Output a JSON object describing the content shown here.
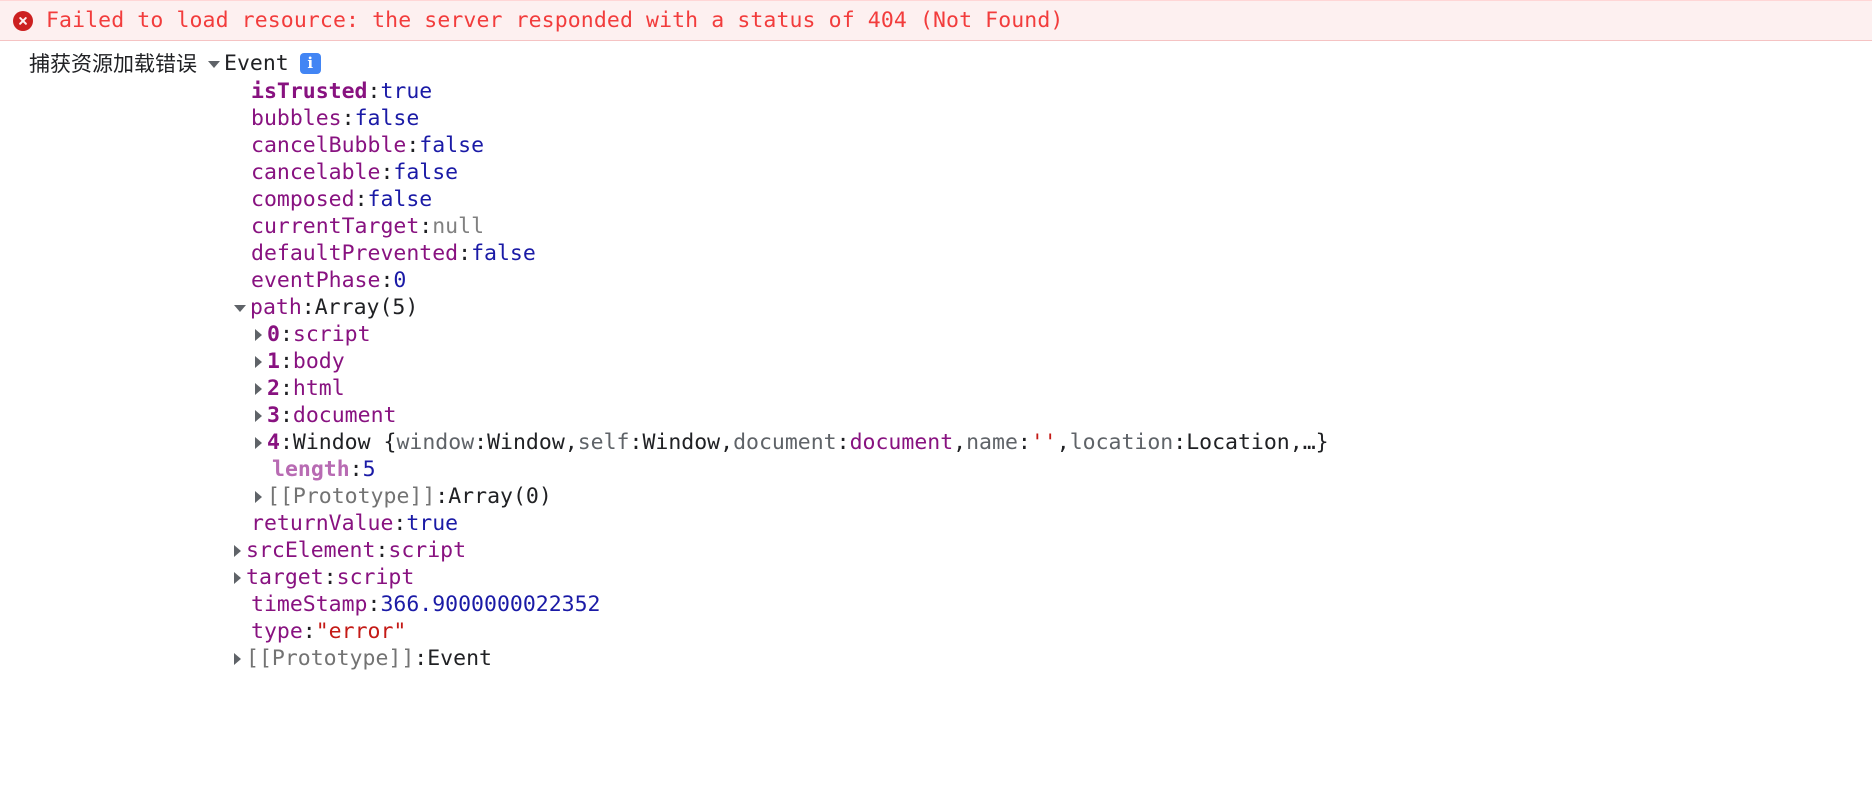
{
  "error_banner": {
    "icon": "error-circle-x-icon",
    "message": "Failed to load resource: the server responded with a status of 404 (Not Found)",
    "color": "#f23c3c",
    "background": "#fdf0f0"
  },
  "log_entry": {
    "label": "捕获资源加载错误",
    "expander": "▼",
    "constructor": "Event",
    "info_icon": "info-icon",
    "info_icon_color": "#4285f4"
  },
  "properties": [
    {
      "indent": "prop",
      "disclosure": "none",
      "key": "isTrusted",
      "keystyle": "key-own",
      "value": "true",
      "valuestyle": "v-bool"
    },
    {
      "indent": "prop",
      "disclosure": "none",
      "key": "bubbles",
      "keystyle": "key",
      "value": "false",
      "valuestyle": "v-bool"
    },
    {
      "indent": "prop",
      "disclosure": "none",
      "key": "cancelBubble",
      "keystyle": "key",
      "value": "false",
      "valuestyle": "v-bool"
    },
    {
      "indent": "prop",
      "disclosure": "none",
      "key": "cancelable",
      "keystyle": "key",
      "value": "false",
      "valuestyle": "v-bool"
    },
    {
      "indent": "prop",
      "disclosure": "none",
      "key": "composed",
      "keystyle": "key",
      "value": "false",
      "valuestyle": "v-bool"
    },
    {
      "indent": "prop",
      "disclosure": "none",
      "key": "currentTarget",
      "keystyle": "key",
      "value": "null",
      "valuestyle": "v-null"
    },
    {
      "indent": "prop",
      "disclosure": "none",
      "key": "defaultPrevented",
      "keystyle": "key",
      "value": "false",
      "valuestyle": "v-bool"
    },
    {
      "indent": "prop",
      "disclosure": "none",
      "key": "eventPhase",
      "keystyle": "key",
      "value": "0",
      "valuestyle": "v-num"
    },
    {
      "indent": "prop-tri",
      "disclosure": "down",
      "key": "path",
      "keystyle": "key",
      "value": "Array(5)",
      "valuestyle": "v-obj"
    },
    {
      "indent": "sub-tri",
      "disclosure": "right",
      "key": "0",
      "keystyle": "key-idx",
      "value": "script",
      "valuestyle": "v-node"
    },
    {
      "indent": "sub-tri",
      "disclosure": "right",
      "key": "1",
      "keystyle": "key-idx",
      "value": "body",
      "valuestyle": "v-node"
    },
    {
      "indent": "sub-tri",
      "disclosure": "right",
      "key": "2",
      "keystyle": "key-idx",
      "value": "html",
      "valuestyle": "v-node"
    },
    {
      "indent": "sub-tri",
      "disclosure": "right",
      "key": "3",
      "keystyle": "key-idx",
      "value": "document",
      "valuestyle": "v-node"
    },
    {
      "indent": "sub-tri",
      "disclosure": "right",
      "key": "4",
      "keystyle": "key-idx",
      "value": "WINDOW_PREVIEW",
      "valuestyle": "v-obj"
    },
    {
      "indent": "sub",
      "disclosure": "none",
      "key": "length",
      "keystyle": "key-dim",
      "value": "5",
      "valuestyle": "v-num"
    },
    {
      "indent": "sub-tri",
      "disclosure": "right",
      "key": "[[Prototype]]",
      "keystyle": "key-proto",
      "value": "Array(0)",
      "valuestyle": "v-obj"
    },
    {
      "indent": "prop",
      "disclosure": "none",
      "key": "returnValue",
      "keystyle": "key",
      "value": "true",
      "valuestyle": "v-bool"
    },
    {
      "indent": "prop-tri",
      "disclosure": "right",
      "key": "srcElement",
      "keystyle": "key",
      "value": "script",
      "valuestyle": "v-node"
    },
    {
      "indent": "prop-tri",
      "disclosure": "right",
      "key": "target",
      "keystyle": "key",
      "value": "script",
      "valuestyle": "v-node"
    },
    {
      "indent": "prop",
      "disclosure": "none",
      "key": "timeStamp",
      "keystyle": "key",
      "value": "366.9000000022352",
      "valuestyle": "v-num"
    },
    {
      "indent": "prop",
      "disclosure": "none",
      "key": "type",
      "keystyle": "key",
      "value": "\"error\"",
      "valuestyle": "v-str"
    },
    {
      "indent": "prop-tri",
      "disclosure": "right",
      "key": "[[Prototype]]",
      "keystyle": "key-proto",
      "value": "Event",
      "valuestyle": "v-obj"
    }
  ],
  "window_preview": {
    "prefix": "Window {",
    "entries": [
      {
        "key": "window",
        "value": "Window",
        "valuestyle": "v-obj"
      },
      {
        "key": "self",
        "value": "Window",
        "valuestyle": "v-obj"
      },
      {
        "key": "document",
        "value": "document",
        "valuestyle": "v-node"
      },
      {
        "key": "name",
        "value": "''",
        "valuestyle": "v-str"
      },
      {
        "key": "location",
        "value": "Location",
        "valuestyle": "v-obj"
      }
    ],
    "ellipsis": "…",
    "suffix": "}"
  }
}
